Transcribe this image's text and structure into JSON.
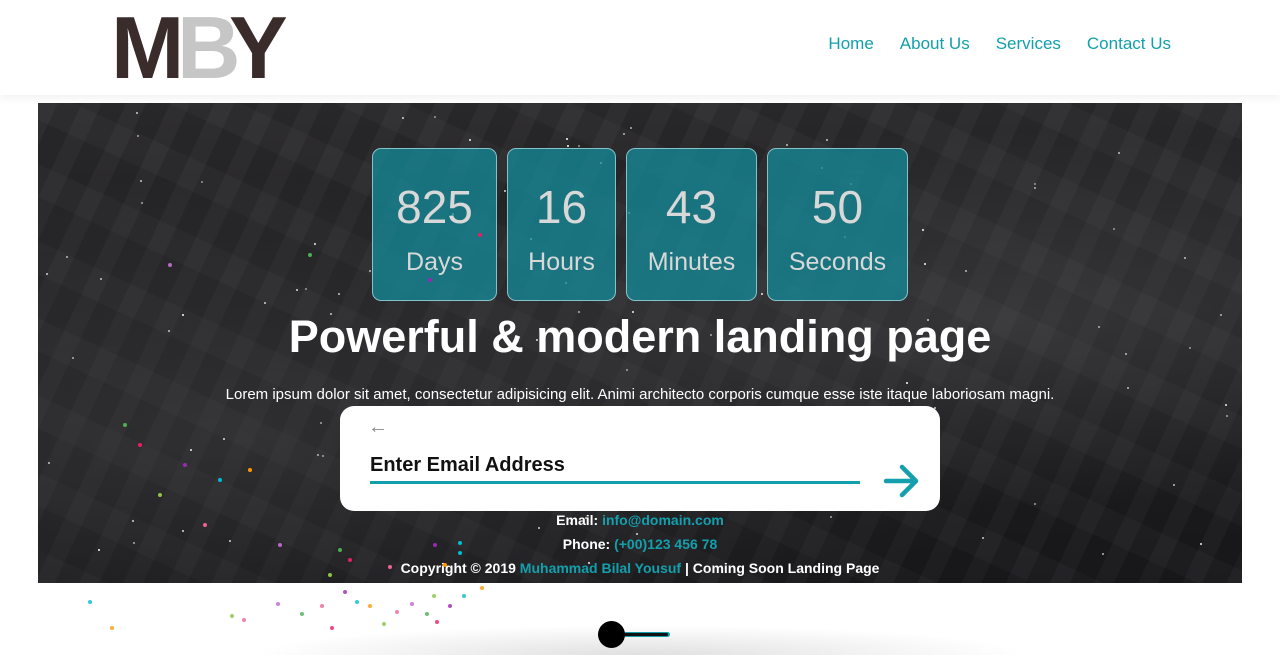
{
  "logo": {
    "letters": [
      "M",
      "B",
      "Y"
    ],
    "colors": [
      "#3a2c2b",
      "#c6c6c6",
      "#3a2c2b"
    ]
  },
  "nav": {
    "items": [
      "Home",
      "About Us",
      "Services",
      "Contact Us"
    ],
    "color": "#13a0ac"
  },
  "countdown": [
    {
      "value": "825",
      "unit": "Days"
    },
    {
      "value": "16",
      "unit": "Hours"
    },
    {
      "value": "43",
      "unit": "Minutes"
    },
    {
      "value": "50",
      "unit": "Seconds"
    }
  ],
  "hero": {
    "headline": "Powerful & modern landing page",
    "subline": "Lorem ipsum dolor sit amet, consectetur adipisicing elit. Animi architecto corporis cumque esse iste itaque laboriosam magni."
  },
  "subscribe": {
    "back_icon": "arrow-left-icon",
    "placeholder": "Enter Email Address",
    "submit_icon": "arrow-right-icon"
  },
  "contact": {
    "email_label": "Email:",
    "email": "info@domain.com",
    "phone_label": "Phone:",
    "phone": "(+00)123 456 78",
    "copyright_prefix": "Copyright © 2019",
    "author": "Muhammad Bilal Yousuf",
    "copyright_suffix": "| Coming Soon Landing Page"
  },
  "colors": {
    "accent": "#13a0ac",
    "counter_bg": "#148c9b"
  }
}
